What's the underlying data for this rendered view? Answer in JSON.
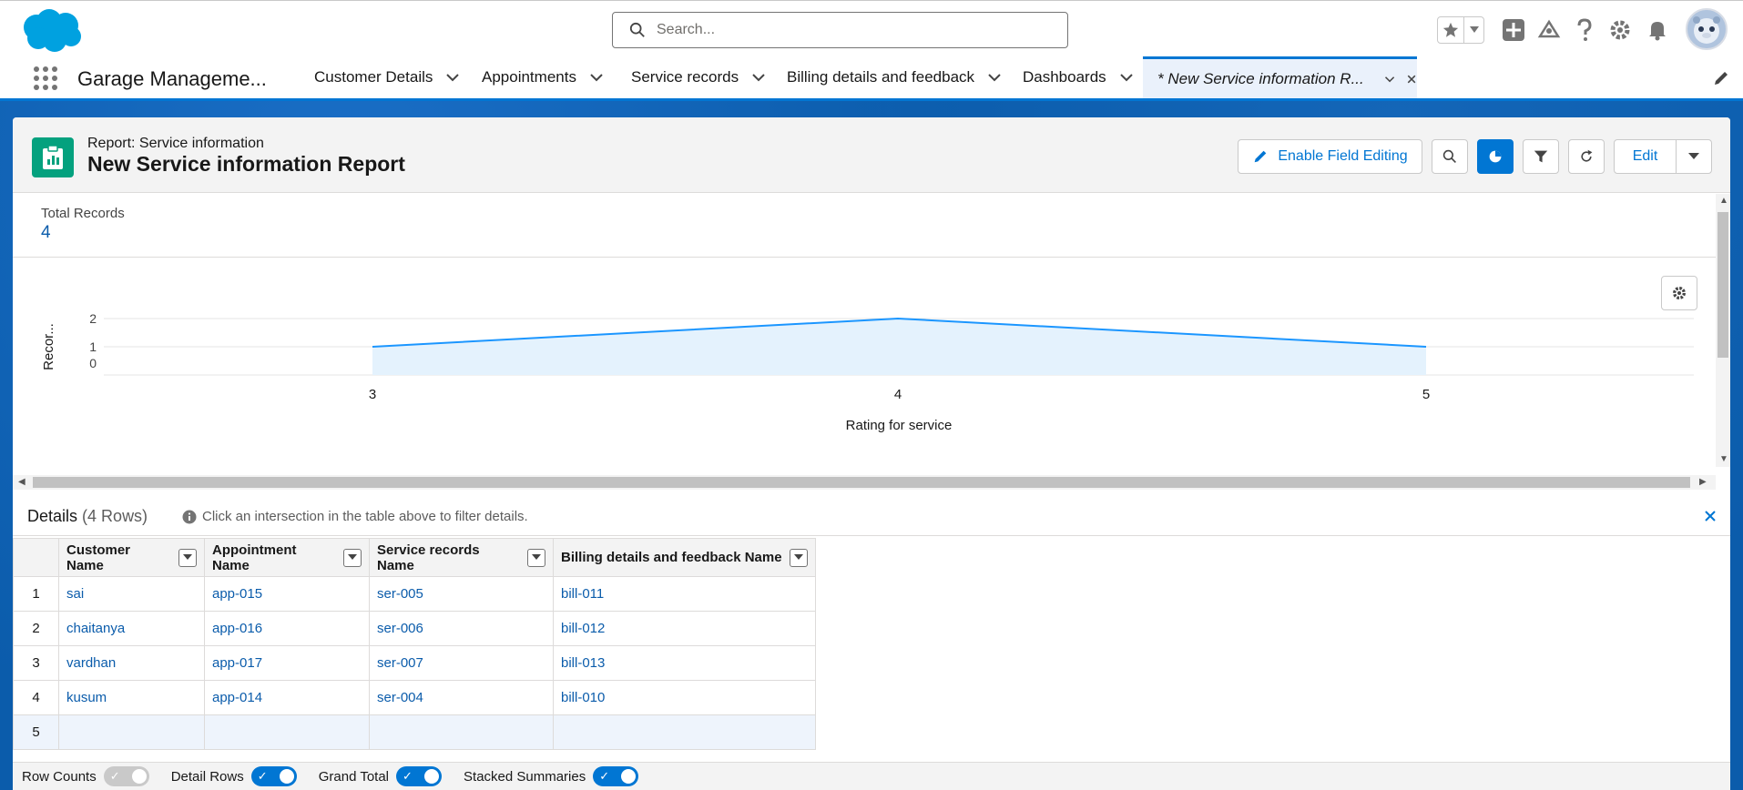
{
  "search": {
    "placeholder": "Search..."
  },
  "app": {
    "name": "Garage Manageme..."
  },
  "nav": {
    "tabs": [
      {
        "label": "Customer Details"
      },
      {
        "label": "Appointments"
      },
      {
        "label": "Service records"
      },
      {
        "label": "Billing details and feedback"
      },
      {
        "label": "Dashboards"
      }
    ],
    "active_tab": {
      "label": "* New Service information R..."
    }
  },
  "report": {
    "type_label": "Report: Service information",
    "title": "New Service information Report",
    "enable_field_editing": "Enable Field Editing",
    "edit_label": "Edit"
  },
  "summary": {
    "total_label": "Total Records",
    "total_value": "4"
  },
  "chart_data": {
    "type": "area",
    "x": [
      "3",
      "4",
      "5"
    ],
    "series": [
      {
        "values": [
          1,
          2,
          1
        ]
      }
    ],
    "xlabel": "Rating for service",
    "ylabel": "Recor...",
    "yticks": [
      "0",
      "1",
      "2"
    ],
    "ylim": [
      0,
      2
    ],
    "grid": true,
    "colors": {
      "line": "#1b96ff",
      "fill": "#e4f2fd"
    }
  },
  "details": {
    "title": "Details",
    "count": "(4 Rows)",
    "hint": "Click an intersection in the table above to filter details.",
    "columns": [
      "Customer Name",
      "Appointment Name",
      "Service records Name",
      "Billing details and feedback Name"
    ],
    "rows": [
      {
        "num": "1",
        "cells": [
          "sai",
          "app-015",
          "ser-005",
          "bill-011"
        ]
      },
      {
        "num": "2",
        "cells": [
          "chaitanya",
          "app-016",
          "ser-006",
          "bill-012"
        ]
      },
      {
        "num": "3",
        "cells": [
          "vardhan",
          "app-017",
          "ser-007",
          "bill-013"
        ]
      },
      {
        "num": "4",
        "cells": [
          "kusum",
          "app-014",
          "ser-004",
          "bill-010"
        ]
      }
    ],
    "empty_row_num": "5"
  },
  "footer": {
    "row_counts": "Row Counts",
    "detail_rows": "Detail Rows",
    "grand_total": "Grand Total",
    "stacked_summaries": "Stacked Summaries"
  }
}
